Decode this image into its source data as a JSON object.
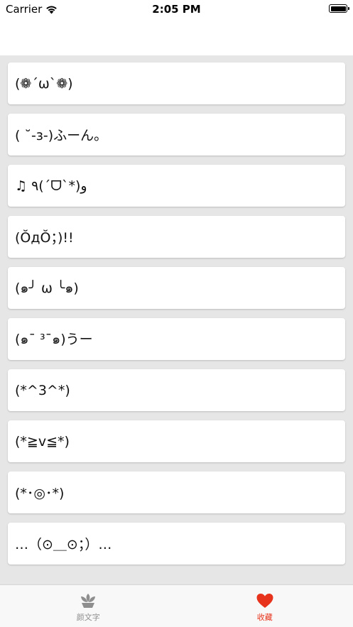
{
  "status_bar": {
    "carrier": "Carrier",
    "time": "2:05 PM"
  },
  "favorites": [
    "(❁´ω`❁)",
    "( ˘-з-)ふーん。",
    "♫ ٩(ˊᗜˋ*)و",
    "(ŎдŎ；)!!",
    "(๑╯ ω ╰๑)",
    "(๑¯ ³¯๑)うー",
    "(*^3^*)",
    "(*≧v≦*)",
    "(*･◎･*)",
    "…（⊙＿⊙；）…"
  ],
  "tab_bar": {
    "tabs": [
      {
        "label": "颜文字",
        "icon": "lotus-icon",
        "color": "#8e8e8e"
      },
      {
        "label": "收藏",
        "icon": "heart-icon",
        "color": "#e8331c"
      }
    ]
  }
}
